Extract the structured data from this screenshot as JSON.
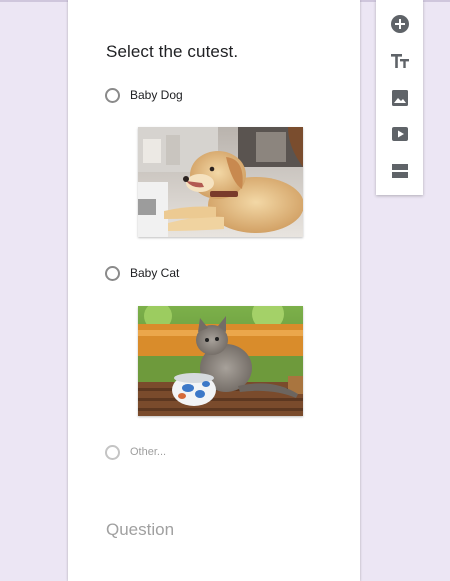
{
  "question": {
    "title": "Select the cutest.",
    "options": [
      {
        "label": "Baby Dog",
        "image": "dog-photo"
      },
      {
        "label": "Baby Cat",
        "image": "cat-photo"
      }
    ],
    "other_label": "Other..."
  },
  "next_question_placeholder": "Question",
  "toolbar": {
    "items": [
      {
        "icon": "add-circle-icon"
      },
      {
        "icon": "text-title-icon"
      },
      {
        "icon": "image-icon"
      },
      {
        "icon": "video-icon"
      },
      {
        "icon": "section-icon"
      }
    ]
  },
  "colors": {
    "background": "#ece6f4",
    "card": "#ffffff",
    "icon": "#5f6368"
  }
}
